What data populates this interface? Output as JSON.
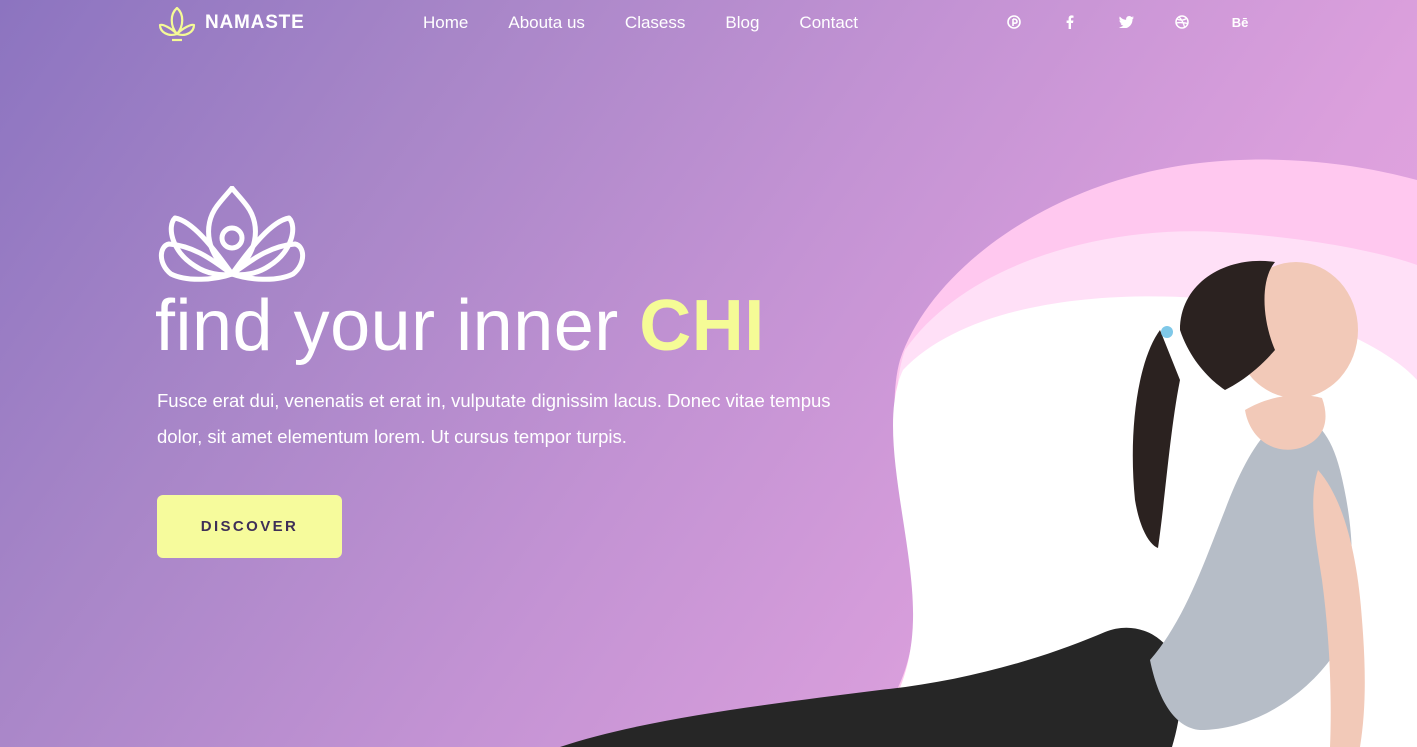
{
  "brand": {
    "name": "NAMASTE"
  },
  "nav": {
    "home": "Home",
    "about": "Abouta us",
    "classes": "Clasess",
    "blog": "Blog",
    "contact": "Contact"
  },
  "social": [
    "pinterest-icon",
    "facebook-icon",
    "twitter-icon",
    "dribbble-icon",
    "behance-icon"
  ],
  "social_labels": {
    "behance": "Bē"
  },
  "hero": {
    "headline_main": "find your inner ",
    "headline_accent": "CHI",
    "description": "Fusce erat dui, venenatis et erat in, vulputate dignissim lacus. Donec vitae tempus dolor, sit amet elementum lorem. Ut cursus tempor turpis.",
    "cta_label": "DISCOVER"
  },
  "colors": {
    "accent": "#f6fb9c",
    "gradient_start": "#8c74c0",
    "gradient_end": "#e8a9e0",
    "wave_pink": "#ffc8ef",
    "button_text": "#3e2f57"
  }
}
